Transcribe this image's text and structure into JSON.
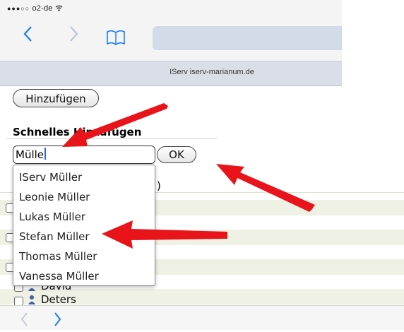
{
  "status_bar": {
    "signal": "●●●○○",
    "carrier": "o2-de",
    "wifi": "ᯤ"
  },
  "browser": {
    "back_icon": "chevron-left-icon",
    "forward_icon": "chevron-right-icon",
    "bookmarks_icon": "book-icon",
    "tab_title": "IServ iserv-marianum.de"
  },
  "page": {
    "add_button": "Hinzufügen",
    "section_title": "Schnelles Hinzufügen",
    "search_value": "Mülle",
    "ok_button": "OK",
    "paren_text": ")",
    "rows": [
      "David",
      "Deters"
    ]
  },
  "autocomplete": {
    "items": [
      "IServ Müller",
      "Leonie Müller",
      "Lukas Müller",
      "Stefan Müller",
      "Thomas Müller",
      "Vanessa Müller"
    ]
  },
  "colors": {
    "accent": "#1a7cf6",
    "annotation_arrow": "#e8141a",
    "row_stripe": "#eef1e4"
  },
  "bottom_bar": {
    "back_label": "‹",
    "forward_label": "›"
  }
}
